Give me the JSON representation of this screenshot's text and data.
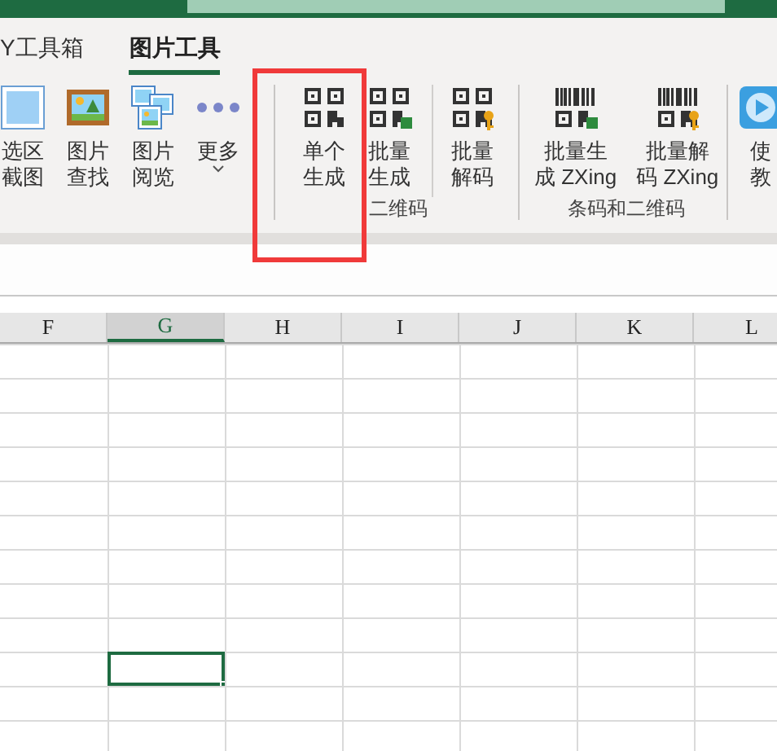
{
  "tabs": [
    {
      "label": "Y工具箱",
      "selected": false
    },
    {
      "label": "图片工具",
      "selected": true
    }
  ],
  "ribbon_groups": [
    {
      "buttons": [
        {
          "kind": "screenshot",
          "lines": [
            "选区",
            "截图"
          ]
        },
        {
          "kind": "picture",
          "lines": [
            "图片",
            "查找"
          ]
        },
        {
          "kind": "gallery",
          "lines": [
            "图片",
            "阅览"
          ]
        },
        {
          "kind": "more",
          "lines": [
            "更多"
          ],
          "dropdown": true
        }
      ]
    },
    {
      "label": "二维码",
      "buttons": [
        {
          "kind": "qr",
          "lines": [
            "单个",
            "生成"
          ]
        },
        {
          "kind": "qr-batch",
          "lines": [
            "批量",
            "生成"
          ]
        },
        {
          "kind": "qr-decode",
          "lines": [
            "批量",
            "解码"
          ],
          "separated": true
        }
      ]
    },
    {
      "label": "条码和二维码",
      "buttons": [
        {
          "kind": "barcode-batch",
          "lines": [
            "批量生",
            "成 ZXing"
          ]
        },
        {
          "kind": "barcode-decode",
          "lines": [
            "批量解",
            "码 ZXing"
          ]
        }
      ]
    },
    {
      "buttons": [
        {
          "kind": "video",
          "lines": [
            "使",
            "教"
          ]
        }
      ]
    }
  ],
  "highlight": {
    "shown": true
  },
  "grid": {
    "columns": [
      {
        "label": "F",
        "selected": false
      },
      {
        "label": "G",
        "selected": true
      },
      {
        "label": "H",
        "selected": false
      },
      {
        "label": "I",
        "selected": false
      },
      {
        "label": "J",
        "selected": false
      },
      {
        "label": "K",
        "selected": false
      },
      {
        "label": "L",
        "selected": false
      }
    ],
    "rows": [
      {
        "selected": false
      },
      {
        "selected": false
      },
      {
        "selected": false
      },
      {
        "selected": false
      },
      {
        "selected": false
      },
      {
        "selected": false
      },
      {
        "selected": false
      },
      {
        "selected": false
      },
      {
        "selected": false
      },
      {
        "selected": true
      },
      {
        "selected": false
      },
      {
        "selected": false
      }
    ]
  }
}
